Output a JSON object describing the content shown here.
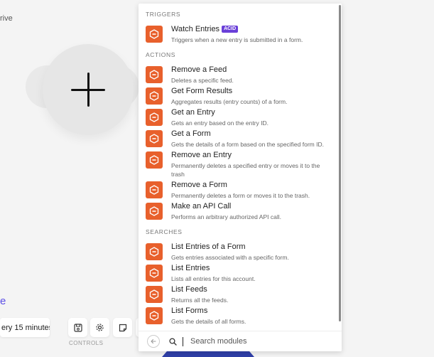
{
  "canvas": {
    "partial_label": "rive",
    "partial_link": "e",
    "schedule_text": "ery 15 minutes.",
    "controls_label": "CONTROLS",
    "controls": [
      {
        "icon": "save-icon"
      },
      {
        "icon": "gear-icon"
      },
      {
        "icon": "note-icon"
      }
    ]
  },
  "panel": {
    "sections": [
      {
        "title": "TRIGGERS",
        "modules": [
          {
            "title": "Watch Entries",
            "badge": "ACID",
            "desc": "Triggers when a new entry is submitted in a form."
          }
        ]
      },
      {
        "title": "ACTIONS",
        "modules": [
          {
            "title": "Remove a Feed",
            "desc": "Deletes a specific feed."
          },
          {
            "title": "Get Form Results",
            "desc": "Aggregates results (entry counts) of a form."
          },
          {
            "title": "Get an Entry",
            "desc": "Gets an entry based on the entry ID."
          },
          {
            "title": "Get a Form",
            "desc": "Gets the details of a form based on the specified form ID."
          },
          {
            "title": "Remove an Entry",
            "desc": "Permanently deletes a specified entry or moves it to the trash"
          },
          {
            "title": "Remove a Form",
            "desc": "Permanently deletes a form or moves it to the trash."
          },
          {
            "title": "Make an API Call",
            "desc": "Performs an arbitrary authorized API call."
          }
        ]
      },
      {
        "title": "SEARCHES",
        "modules": [
          {
            "title": "List Entries of a Form",
            "desc": "Gets entries associated with a specific form."
          },
          {
            "title": "List Entries",
            "desc": "Lists all entries for this account."
          },
          {
            "title": "List Feeds",
            "desc": "Returns all the feeds."
          },
          {
            "title": "List Forms",
            "desc": "Gets the details of all forms."
          }
        ]
      }
    ],
    "search": {
      "placeholder": "Search modules",
      "value": ""
    }
  },
  "colors": {
    "module_icon": "#e8602c",
    "badge": "#6a3fd8",
    "link": "#5b4ee6"
  }
}
